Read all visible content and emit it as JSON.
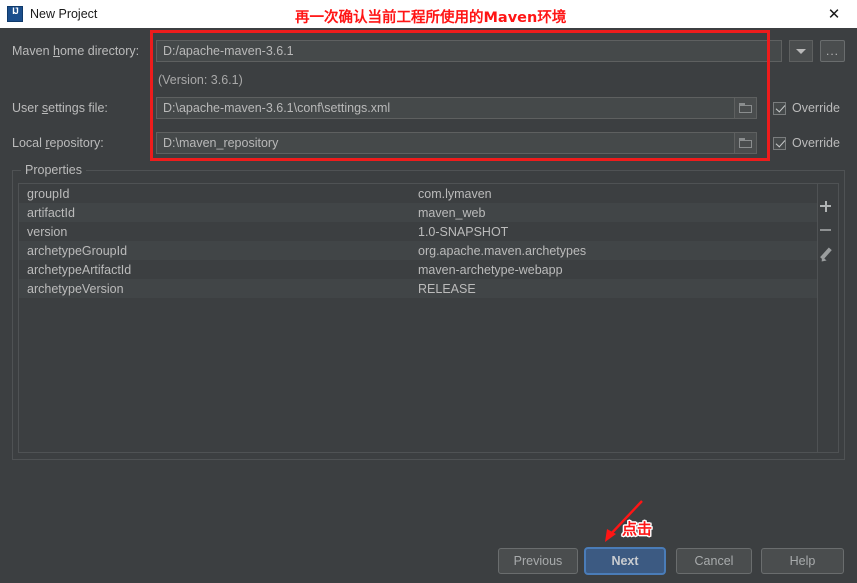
{
  "window": {
    "title": "New Project",
    "icon": "intellij-idea-logo-icon",
    "close_label": "✕"
  },
  "form": {
    "maven_home": {
      "label_pre": "Maven ",
      "label_mnemonic": "h",
      "label_post": "ome directory:",
      "value": "D:/apache-maven-3.6.1",
      "dropdown_icon": "chevron-down-icon",
      "browse_label": "..."
    },
    "version_note": "(Version: 3.6.1)",
    "user_settings": {
      "label_pre": "User ",
      "label_mnemonic": "s",
      "label_post": "ettings file:",
      "value": "D:\\apache-maven-3.6.1\\conf\\settings.xml",
      "folder_icon": "folder-icon",
      "override_label": "Override",
      "override_checked": true
    },
    "local_repository": {
      "label_pre": "Local ",
      "label_mnemonic": "r",
      "label_post": "epository:",
      "value": "D:\\maven_repository",
      "folder_icon": "folder-icon",
      "override_label": "Override",
      "override_checked": true
    }
  },
  "properties": {
    "legend": "Properties",
    "rows": [
      {
        "key": "groupId",
        "value": "com.lymaven"
      },
      {
        "key": "artifactId",
        "value": "maven_web"
      },
      {
        "key": "version",
        "value": "1.0-SNAPSHOT"
      },
      {
        "key": "archetypeGroupId",
        "value": "org.apache.maven.archetypes"
      },
      {
        "key": "archetypeArtifactId",
        "value": "maven-archetype-webapp"
      },
      {
        "key": "archetypeVersion",
        "value": "RELEASE"
      }
    ],
    "toolbar": {
      "add_icon": "plus-icon",
      "remove_icon": "minus-icon",
      "edit_icon": "pencil-icon"
    }
  },
  "buttons": {
    "previous": "Previous",
    "next": "Next",
    "cancel": "Cancel",
    "help": "Help"
  },
  "annotations": {
    "top_note": "再一次确认当前工程所使用的Maven环境",
    "click_note": "点击"
  },
  "colors": {
    "annotation_red": "#ff1515",
    "primary_button": "#3c5a82",
    "window_background": "#3c3f41"
  }
}
